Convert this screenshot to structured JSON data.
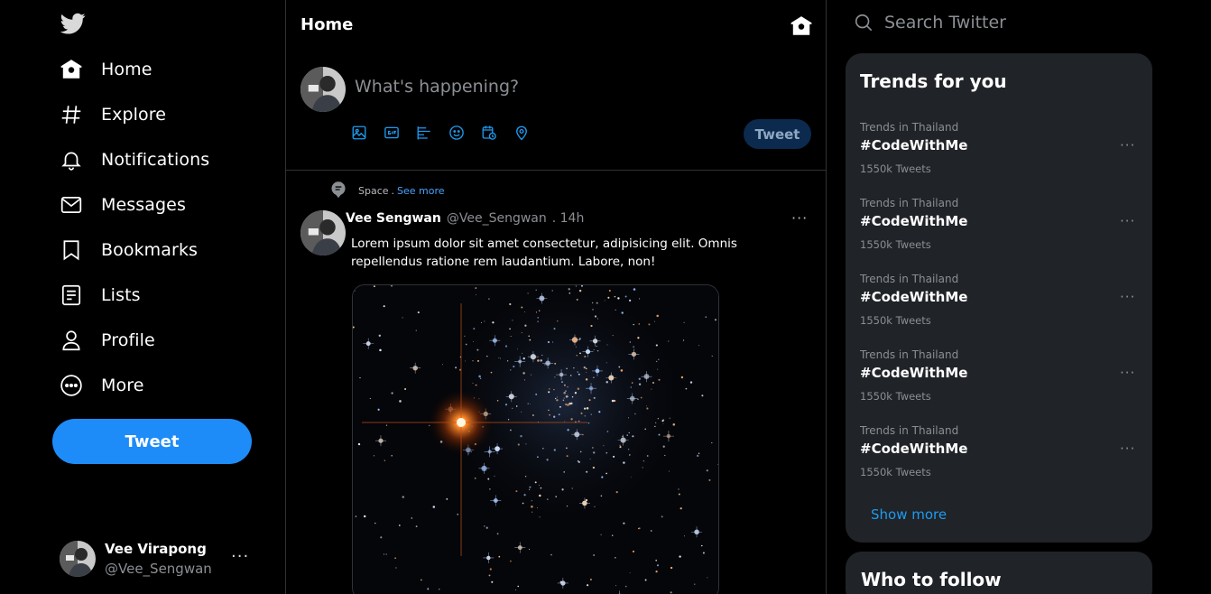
{
  "nav": {
    "items": [
      {
        "label": "Home",
        "icon": "home-icon"
      },
      {
        "label": "Explore",
        "icon": "hashtag-icon"
      },
      {
        "label": "Notifications",
        "icon": "bell-icon"
      },
      {
        "label": "Messages",
        "icon": "mail-icon"
      },
      {
        "label": "Bookmarks",
        "icon": "bookmark-icon"
      },
      {
        "label": "Lists",
        "icon": "list-icon"
      },
      {
        "label": "Profile",
        "icon": "person-icon"
      },
      {
        "label": "More",
        "icon": "more-circle-icon"
      }
    ],
    "tweet_button": "Tweet"
  },
  "account": {
    "name": "Vee Virapong",
    "handle": "@Vee_Sengwan",
    "more": "···"
  },
  "main": {
    "title": "Home",
    "compose": {
      "placeholder": "What's happening?",
      "tweet_button": "Tweet"
    },
    "tweet": {
      "context": "Space",
      "context_sep": ".",
      "context_link": "See more",
      "name": "Vee Sengwan",
      "handle": "@Vee_Sengwan",
      "time": ". 14h",
      "more": "···",
      "text": "Lorem ipsum dolor sit amet consectetur, adipisicing elit. Omnis repellendus ratione rem laudantium. Labore, non!"
    }
  },
  "sidebar_right": {
    "search_placeholder": "Search Twitter",
    "trends_title": "Trends for you",
    "trends": [
      {
        "location": "Trends in Thailand",
        "tag": "#CodeWithMe",
        "count": "1550k Tweets"
      },
      {
        "location": "Trends in Thailand",
        "tag": "#CodeWithMe",
        "count": "1550k Tweets"
      },
      {
        "location": "Trends in Thailand",
        "tag": "#CodeWithMe",
        "count": "1550k Tweets"
      },
      {
        "location": "Trends in Thailand",
        "tag": "#CodeWithMe",
        "count": "1550k Tweets"
      },
      {
        "location": "Trends in Thailand",
        "tag": "#CodeWithMe",
        "count": "1550k Tweets"
      }
    ],
    "trend_more": "···",
    "show_more": "Show more",
    "who_to_follow": "Who to follow"
  },
  "colors": {
    "accent": "#1d8cf8",
    "background": "#000000",
    "panel": "#202327",
    "muted_text": "#8b8f94"
  }
}
